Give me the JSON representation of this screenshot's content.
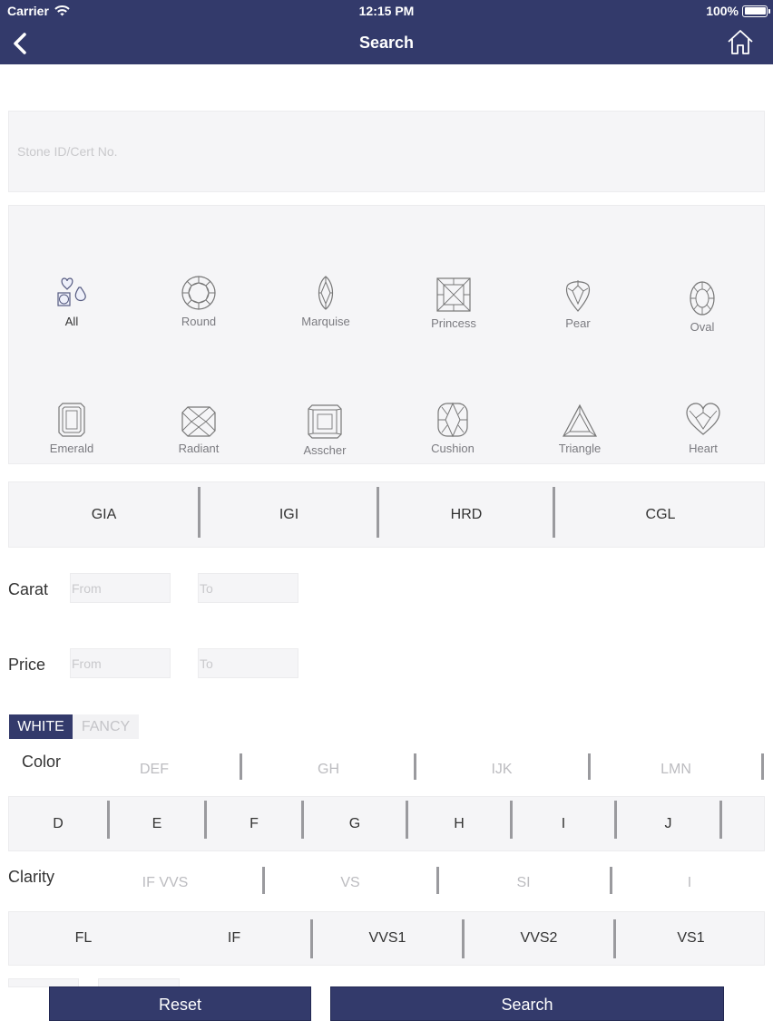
{
  "status_bar": {
    "carrier": "Carrier",
    "time": "12:15 PM",
    "battery": "100%"
  },
  "nav": {
    "title": "Search",
    "back_icon": "chevron-left-icon",
    "home_icon": "home-icon"
  },
  "stone_search": {
    "placeholder": "Stone ID/Cert No.",
    "value": ""
  },
  "shapes": [
    {
      "label": "All",
      "icon": "all-shapes-icon",
      "selected": true
    },
    {
      "label": "Round",
      "icon": "round-diamond-icon"
    },
    {
      "label": "Marquise",
      "icon": "marquise-diamond-icon"
    },
    {
      "label": "Princess",
      "icon": "princess-diamond-icon"
    },
    {
      "label": "Pear",
      "icon": "pear-diamond-icon"
    },
    {
      "label": "Oval",
      "icon": "oval-diamond-icon"
    },
    {
      "label": "Emerald",
      "icon": "emerald-diamond-icon"
    },
    {
      "label": "Radiant",
      "icon": "radiant-diamond-icon"
    },
    {
      "label": "Asscher",
      "icon": "asscher-diamond-icon"
    },
    {
      "label": "Cushion",
      "icon": "cushion-diamond-icon"
    },
    {
      "label": "Triangle",
      "icon": "triangle-diamond-icon"
    },
    {
      "label": "Heart",
      "icon": "heart-diamond-icon"
    }
  ],
  "labs": [
    "GIA",
    "IGI",
    "HRD",
    "CGL"
  ],
  "carat": {
    "label": "Carat",
    "from_placeholder": "From",
    "to_placeholder": "To"
  },
  "price": {
    "label": "Price",
    "from_placeholder": "From",
    "to_placeholder": "To"
  },
  "color_type": {
    "white": "WHITE",
    "fancy": "FANCY",
    "selected": "WHITE"
  },
  "color": {
    "label": "Color",
    "groups": [
      "DEF",
      "GH",
      "IJK",
      "LMN"
    ],
    "grades": [
      "D",
      "E",
      "F",
      "G",
      "H",
      "I",
      "J"
    ]
  },
  "clarity": {
    "label": "Clarity",
    "groups": [
      "IF VVS",
      "VS",
      "SI",
      "I"
    ],
    "grades": [
      "FL",
      "IF",
      "VVS1",
      "VVS2",
      "VS1"
    ]
  },
  "buttons": {
    "reset": "Reset",
    "search": "Search"
  },
  "colors": {
    "navy": "#333a6b",
    "panel": "#f5f5f7",
    "separator": "#9a9a9e",
    "muted_text": "#7b7b80"
  }
}
